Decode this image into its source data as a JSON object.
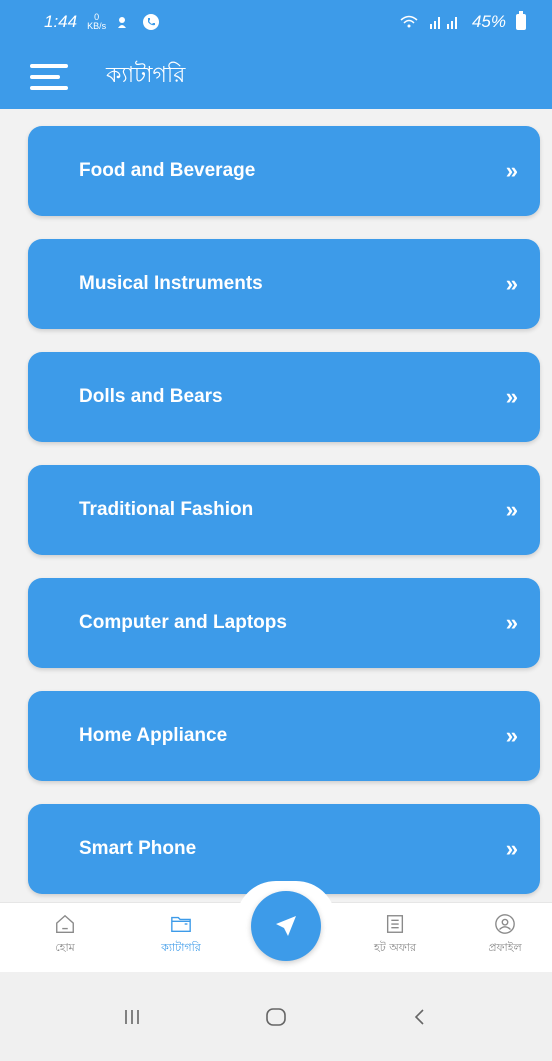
{
  "status_bar": {
    "time": "1:44",
    "net_speed_value": "0",
    "net_speed_unit": "KB/s",
    "battery": "45%"
  },
  "app_bar": {
    "title": "ক্যাটাগরি"
  },
  "categories": [
    {
      "label": "Food and Beverage"
    },
    {
      "label": "Musical Instruments"
    },
    {
      "label": "Dolls and Bears"
    },
    {
      "label": "Traditional Fashion"
    },
    {
      "label": "Computer and Laptops"
    },
    {
      "label": "Home Appliance"
    },
    {
      "label": "Smart Phone"
    }
  ],
  "bottom_nav": {
    "home": "হোম",
    "category": "ক্যাটাগরি",
    "hot_offer": "হট অফার",
    "profile": "প্রফাইল"
  },
  "colors": {
    "primary": "#3d9be9",
    "background": "#f2f2f2",
    "inactive": "#8a8a8a"
  },
  "icons": {
    "menu": "hamburger-icon",
    "chevron": "double-chevron-right-icon",
    "home": "home-icon",
    "category": "folder-icon",
    "send": "send-icon",
    "hot_offer": "list-icon",
    "profile": "user-circle-icon"
  }
}
